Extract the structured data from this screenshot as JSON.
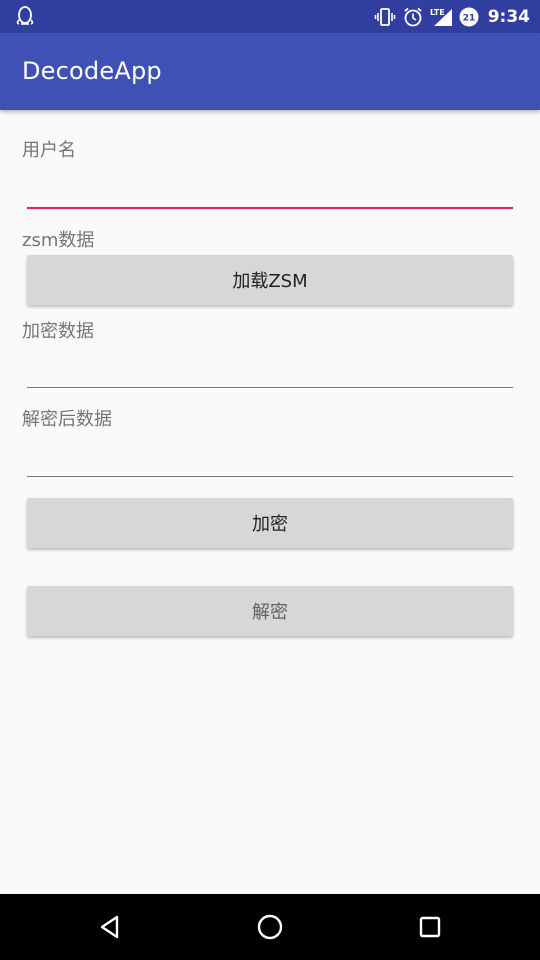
{
  "status_bar": {
    "time": "9:34",
    "left_icon": "qq-penguin-icon",
    "right_icons": [
      "vibrate-icon",
      "alarm-icon",
      "lte-signal-icon",
      "battery-icon"
    ],
    "battery_badge": "21",
    "network_label": "LTE"
  },
  "app_bar": {
    "title": "DecodeApp",
    "color": "#3f51b5",
    "status_color": "#303f9f"
  },
  "form": {
    "username_label": "用户名",
    "username_value": "",
    "zsm_label": "zsm数据",
    "load_zsm_button": "加载ZSM",
    "encrypted_label": "加密数据",
    "encrypted_value": "",
    "decrypted_label": "解密后数据",
    "decrypted_value": "",
    "encrypt_button": "加密",
    "decrypt_button": "解密",
    "accent_color": "#e91e63"
  },
  "nav_bar": {
    "back": "back-icon",
    "home": "home-icon",
    "recents": "recents-icon"
  }
}
